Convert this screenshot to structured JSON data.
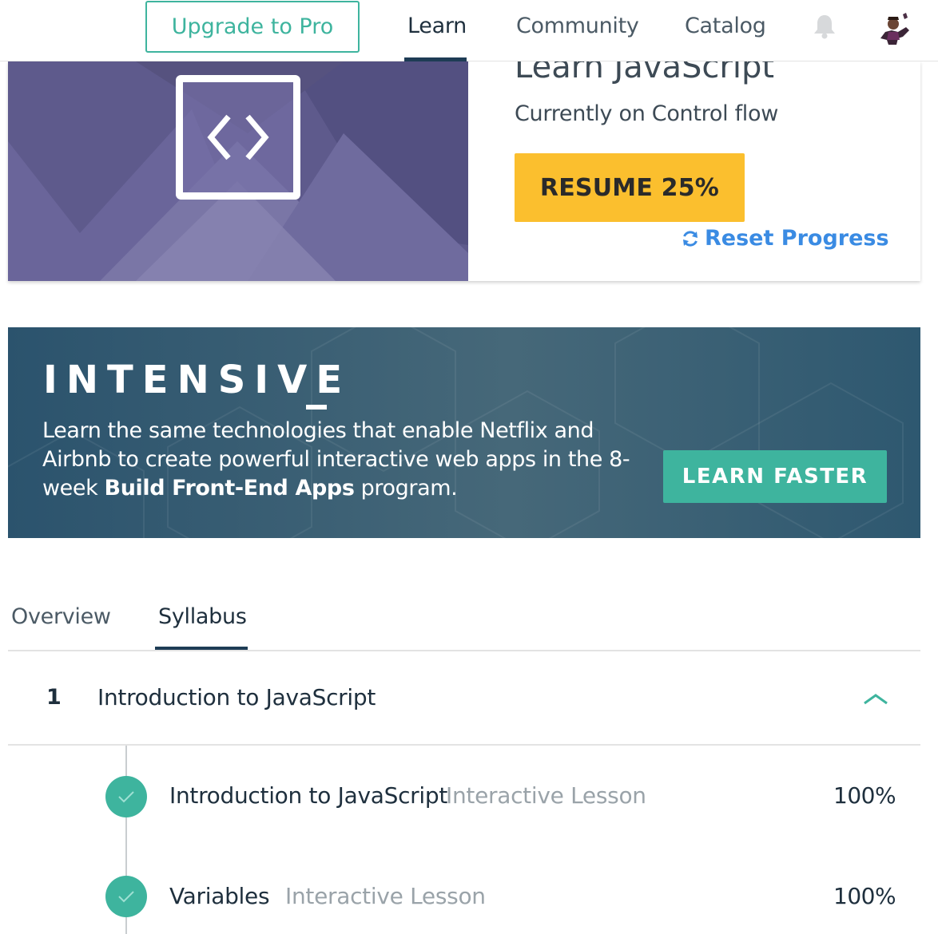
{
  "nav": {
    "upgrade_label": "Upgrade to Pro",
    "links": [
      "Learn",
      "Community",
      "Catalog"
    ],
    "active_link": "Learn",
    "bell_icon": "bell-icon",
    "avatar_icon": "user-avatar"
  },
  "course": {
    "title": "Learn JavaScript",
    "status": "Currently on Control flow",
    "resume_label": "RESUME 25%",
    "progress_percent": 25,
    "reset_label": "Reset Progress",
    "reset_icon": "refresh-icon",
    "banner_icon": "code-brackets-icon"
  },
  "promo": {
    "heading": "INTENSIVE",
    "text_part1": "Learn the same technologies that enable Netflix and Airbnb to create powerful interactive web apps in the 8-week ",
    "text_bold": "Build Front-End Apps",
    "text_part2": " program.",
    "button_label": "LEARN FASTER"
  },
  "tabs": {
    "items": [
      "Overview",
      "Syllabus"
    ],
    "active": "Syllabus"
  },
  "syllabus": {
    "chapter": {
      "number": "1",
      "title": "Introduction to JavaScript",
      "expanded": true
    },
    "lessons": [
      {
        "name": "Introduction to JavaScript",
        "type": "Interactive Lesson",
        "percent": "100%",
        "completed": true
      },
      {
        "name": "Variables",
        "type": "Interactive Lesson",
        "percent": "100%",
        "completed": true
      }
    ]
  },
  "colors": {
    "accent_green": "#3eb49e",
    "resume_yellow": "#fbbf2e",
    "link_blue": "#3a8be3",
    "nav_underline": "#1e3c55"
  }
}
